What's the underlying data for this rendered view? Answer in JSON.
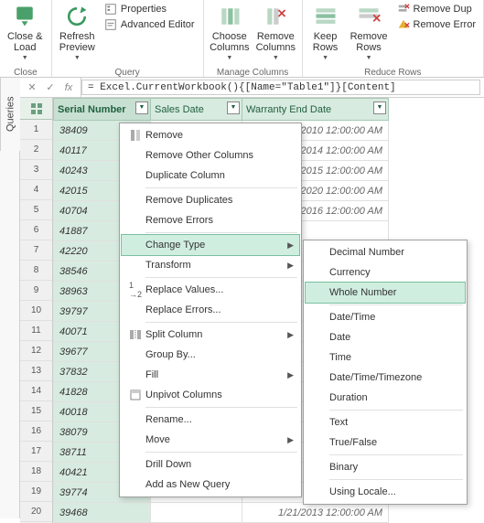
{
  "ribbon": {
    "groups": {
      "close": {
        "label": "Close",
        "close_load": "Close &\nLoad"
      },
      "query": {
        "label": "Query",
        "refresh": "Refresh\nPreview",
        "properties": "Properties",
        "adv_editor": "Advanced Editor"
      },
      "columns": {
        "label": "Manage Columns",
        "choose": "Choose\nColumns",
        "remove": "Remove\nColumns"
      },
      "rows": {
        "label": "Reduce Rows",
        "keep": "Keep\nRows",
        "remove": "Remove\nRows",
        "remove_dup": "Remove Dup",
        "remove_err": "Remove Error"
      }
    }
  },
  "queries_tab": "Queries",
  "formula_bar": {
    "fx": "fx",
    "formula": "= Excel.CurrentWorkbook(){[Name=\"Table1\"]}[Content]"
  },
  "table": {
    "headers": {
      "serial": "Serial Number",
      "sales_date": "Sales Date",
      "warranty": "Warranty End Date"
    },
    "rows": [
      {
        "n": 1,
        "sn": "38409",
        "wd": "2/26/2010 12:00:00 AM"
      },
      {
        "n": 2,
        "sn": "40117",
        "wd": "10/31/2014 12:00:00 AM"
      },
      {
        "n": 3,
        "sn": "40243",
        "wd": "3/6/2015 12:00:00 AM"
      },
      {
        "n": 4,
        "sn": "42015",
        "wd": "1/11/2020 12:00:00 AM"
      },
      {
        "n": 5,
        "sn": "40704",
        "wd": "6/10/2016 12:00:00 AM"
      },
      {
        "n": 6,
        "sn": "41887",
        "wd": ""
      },
      {
        "n": 7,
        "sn": "42220",
        "wd": ""
      },
      {
        "n": 8,
        "sn": "38546",
        "wd": ""
      },
      {
        "n": 9,
        "sn": "38963",
        "wd": ""
      },
      {
        "n": 10,
        "sn": "39797",
        "wd": ""
      },
      {
        "n": 11,
        "sn": "40071",
        "wd": ""
      },
      {
        "n": 12,
        "sn": "39677",
        "wd": ""
      },
      {
        "n": 13,
        "sn": "37832",
        "wd": ""
      },
      {
        "n": 14,
        "sn": "41828",
        "wd": ""
      },
      {
        "n": 15,
        "sn": "40018",
        "wd": ""
      },
      {
        "n": 16,
        "sn": "38079",
        "wd": ""
      },
      {
        "n": 17,
        "sn": "38711",
        "wd": ""
      },
      {
        "n": 18,
        "sn": "40421",
        "wd": ""
      },
      {
        "n": 19,
        "sn": "39774",
        "wd": ""
      },
      {
        "n": 20,
        "sn": "39468",
        "wd": "1/21/2013 12:00:00 AM"
      }
    ]
  },
  "context_menu": {
    "remove": "Remove",
    "remove_other": "Remove Other Columns",
    "duplicate_col": "Duplicate Column",
    "remove_dup": "Remove Duplicates",
    "remove_err": "Remove Errors",
    "change_type": "Change Type",
    "transform": "Transform",
    "replace_val": "Replace Values...",
    "replace_err": "Replace Errors...",
    "split_col": "Split Column",
    "group_by": "Group By...",
    "fill": "Fill",
    "unpivot": "Unpivot Columns",
    "rename": "Rename...",
    "move": "Move",
    "drill": "Drill Down",
    "add_new": "Add as New Query"
  },
  "type_menu": {
    "decimal": "Decimal Number",
    "currency": "Currency",
    "whole": "Whole Number",
    "datetime": "Date/Time",
    "date": "Date",
    "time": "Time",
    "dtz": "Date/Time/Timezone",
    "duration": "Duration",
    "text": "Text",
    "boolean": "True/False",
    "binary": "Binary",
    "locale": "Using Locale..."
  }
}
